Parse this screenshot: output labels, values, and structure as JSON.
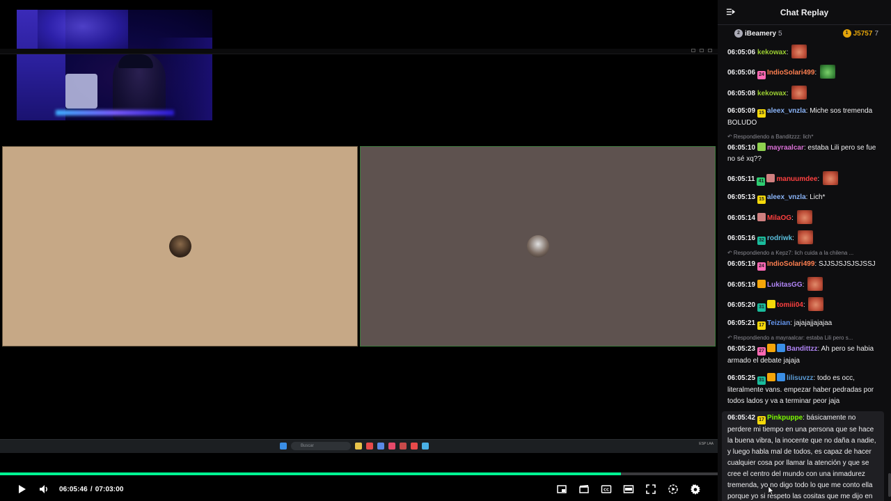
{
  "player": {
    "current_time": "06:05:46",
    "separator": "/",
    "duration": "07:03:00",
    "progress_fraction": 0.865
  },
  "taskbar": {
    "search_placeholder": "Buscar",
    "tray_lang": "ESP LAA"
  },
  "chat": {
    "title": "Chat Replay",
    "leaderboard": [
      {
        "rank_icon": "silver-2",
        "rank": "2",
        "name": "iBeamery",
        "count": "5"
      },
      {
        "rank_icon": "gold-1",
        "rank": "1",
        "name": "J5757",
        "count": "7"
      }
    ],
    "messages": [
      {
        "time": "06:05:06",
        "user": "kekowax",
        "color": "#9acd32",
        "badges": [],
        "text": "",
        "emote": "emote-face"
      },
      {
        "time": "06:05:06",
        "user": "IndioSolari499",
        "color": "#ff7f50",
        "badges": [
          {
            "label": "24",
            "color": "#ff69b4"
          }
        ],
        "text": "",
        "emote": "emote-pepe"
      },
      {
        "time": "06:05:08",
        "user": "kekowax",
        "color": "#9acd32",
        "badges": [],
        "text": "",
        "emote": "emote-face"
      },
      {
        "time": "06:05:09",
        "user": "aleex_vnzla",
        "color": "#8ab4f8",
        "badges": [
          {
            "label": "15",
            "color": "#f5d90a"
          }
        ],
        "text": "Miche sos tremenda BOLUDO",
        "emote": ""
      },
      {
        "reply": "Respondiendo a Banditzzz: lich*"
      },
      {
        "time": "06:05:10",
        "user": "mayraalcar",
        "color": "#da70d6",
        "badges": [
          {
            "label": "",
            "color": "#8fd14f"
          }
        ],
        "text": "estaba Lili pero se fue no sé xq??",
        "emote": ""
      },
      {
        "time": "06:05:11",
        "user": "manuumdee",
        "color": "#ff4040",
        "badges": [
          {
            "label": "41",
            "color": "#2ecc71"
          },
          {
            "label": "",
            "color": "#d08080"
          }
        ],
        "text": "",
        "emote": "emote-face"
      },
      {
        "time": "06:05:13",
        "user": "aleex_vnzla",
        "color": "#8ab4f8",
        "badges": [
          {
            "label": "15",
            "color": "#f5d90a"
          }
        ],
        "text": "Lich*",
        "emote": ""
      },
      {
        "time": "06:05:14",
        "user": "MilaOG",
        "color": "#ff4040",
        "badges": [
          {
            "label": "",
            "color": "#d08080"
          }
        ],
        "text": "",
        "emote": "emote-face"
      },
      {
        "time": "06:05:16",
        "user": "rodriwk",
        "color": "#5bc0de",
        "badges": [
          {
            "label": "32",
            "color": "#1abc9c"
          }
        ],
        "text": "",
        "emote": "emote-face"
      },
      {
        "reply": "Respondiendo a Kepz7: lich cuida a la chilena ..."
      },
      {
        "time": "06:05:19",
        "user": "IndioSolari499",
        "color": "#ff7f50",
        "badges": [
          {
            "label": "24",
            "color": "#ff69b4"
          }
        ],
        "text": "SJJSJSJSJSJSSJ",
        "emote": ""
      },
      {
        "time": "06:05:19",
        "user": "LukitasGG",
        "color": "#b084f5",
        "badges": [
          {
            "label": "",
            "color": "#f5a50a"
          }
        ],
        "text": "",
        "emote": "emote-face"
      },
      {
        "time": "06:05:20",
        "user": "tomiii04",
        "color": "#ff4040",
        "badges": [
          {
            "label": "31",
            "color": "#1abc9c"
          },
          {
            "label": "",
            "color": "#f5d90a"
          }
        ],
        "text": "",
        "emote": "emote-face"
      },
      {
        "time": "06:05:21",
        "user": "Teizian",
        "color": "#6495ed",
        "badges": [
          {
            "label": "17",
            "color": "#f5d90a"
          }
        ],
        "text": "jajajajjajajaa",
        "emote": ""
      },
      {
        "reply": "Respondiendo a mayraalcar: estaba Lili pero s..."
      },
      {
        "time": "06:05:23",
        "user": "Bandittzz",
        "color": "#b084f5",
        "badges": [
          {
            "label": "27",
            "color": "#ff69b4"
          },
          {
            "label": "",
            "color": "#f5a50a"
          },
          {
            "label": "",
            "color": "#3a8ee6"
          }
        ],
        "text": "Ah pero se habia armado el debate jajaja",
        "emote": ""
      },
      {
        "time": "06:05:25",
        "user": "lilisuvzz",
        "color": "#5b9bd5",
        "badges": [
          {
            "label": "31",
            "color": "#1abc9c"
          },
          {
            "label": "",
            "color": "#f5a50a"
          },
          {
            "label": "",
            "color": "#3a8ee6"
          }
        ],
        "text": "todo es occ, literalmente vans. empezar haber pedradas por todos lados y va a terminar peor jaja",
        "emote": ""
      },
      {
        "time": "06:05:42",
        "user": "Pinkpuppe",
        "color": "#7cfc00",
        "badges": [
          {
            "label": "17",
            "color": "#f5d90a"
          }
        ],
        "text": "básicamente no perdere mi tiempo en una persona que se hace la buena vibra, la inocente que no daña a nadie, y luego habla mal de todos, es capaz de hacer cualquier cosa por llamar la atención y que se cree el centro del mundo con una inmadurez tremenda, yo no digo todo lo que me conto ella porque yo si respeto las cositas que me dijo en privado. Besos lesbianos a todos menos a la peackme",
        "emote": "",
        "highlight": true
      }
    ]
  }
}
